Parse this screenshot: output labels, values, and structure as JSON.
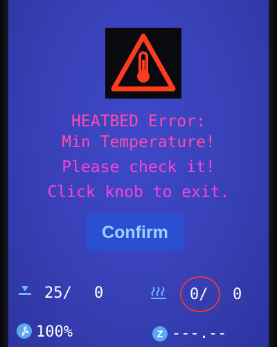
{
  "error": {
    "icon": "thermometer-warning-icon",
    "line1": "HEATBED Error:",
    "line2": "Min Temperature!",
    "line3": "Please check it!",
    "line4": "Click knob to exit."
  },
  "confirm_label": "Confirm",
  "status": {
    "bed_icon": "heatbed-icon",
    "bed_current": "25/",
    "bed_target": "0",
    "nozzle_icon": "heat-waves-icon",
    "nozzle_current": "0/",
    "nozzle_target": "0",
    "fan_icon": "fan-icon",
    "fan_speed": "100%",
    "z_icon": "z-axis-icon",
    "z_position": "---.--"
  },
  "colors": {
    "screen_bg": "#3942ba",
    "message": "#ff40d8",
    "button_bg": "#2a4fd0",
    "button_text": "#9ad4ff",
    "warning_icon": "#ff3b1f",
    "annotation_circle": "#e23a3a"
  }
}
